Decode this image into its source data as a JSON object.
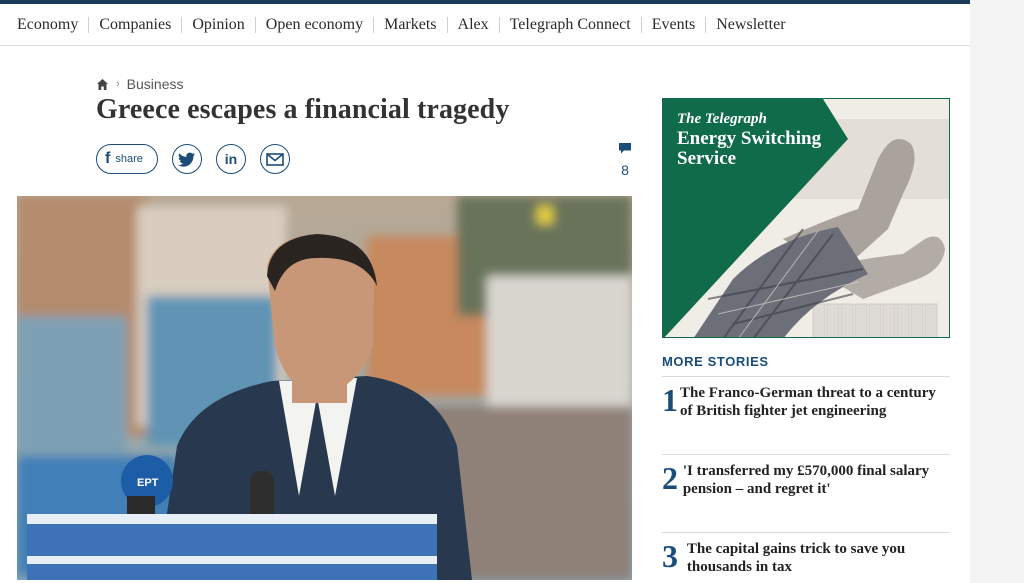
{
  "nav": {
    "items": [
      "Economy",
      "Companies",
      "Opinion",
      "Open economy",
      "Markets",
      "Alex",
      "Telegraph Connect",
      "Events",
      "Newsletter"
    ]
  },
  "breadcrumb": {
    "section": "Business"
  },
  "article": {
    "headline": "Greece escapes a financial tragedy",
    "comment_count": "8",
    "share_label": "share"
  },
  "ad": {
    "logo": "The Telegraph",
    "title_line1": "Energy Switching",
    "title_line2": "Service",
    "accent": "#0f6b4a"
  },
  "more_stories": {
    "title": "MORE STORIES",
    "items": [
      {
        "num": "1",
        "title": "The Franco-German threat to a century of British fighter jet engineering"
      },
      {
        "num": "2",
        "title": "'I transferred my £570,000 final salary pension – and regret it'"
      },
      {
        "num": "3",
        "title": "The capital gains trick to save you thousands in tax"
      }
    ]
  },
  "icons": {
    "home": "home-icon",
    "chevron": "chevron-right-icon",
    "facebook": "facebook-icon",
    "twitter": "twitter-icon",
    "linkedin": "linkedin-icon",
    "email": "email-icon",
    "comment": "comment-icon"
  },
  "colors": {
    "brand": "#1a4d7a",
    "topbar": "#1a3c5a"
  }
}
